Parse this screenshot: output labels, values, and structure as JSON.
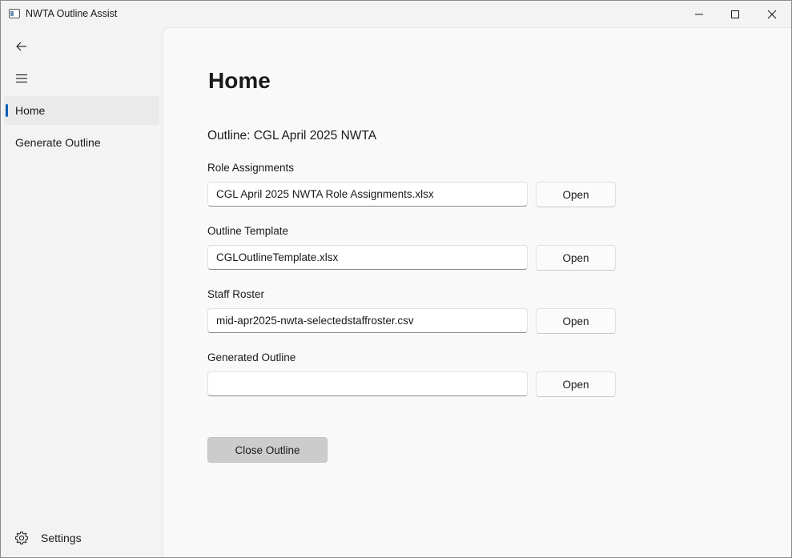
{
  "window": {
    "title": "NWTA Outline Assist"
  },
  "title_bar": {
    "icons": {
      "app": "app-window-icon",
      "minimize": "minimize-icon",
      "maximize": "maximize-icon",
      "close": "close-icon"
    }
  },
  "nav": {
    "back_icon": "arrow-left-icon",
    "menu_icon": "hamburger-menu-icon",
    "items": [
      {
        "label": "Home",
        "selected": true
      },
      {
        "label": "Generate Outline",
        "selected": false
      }
    ],
    "settings": {
      "label": "Settings",
      "icon": "gear-icon"
    },
    "accent_color": "#005fb8"
  },
  "page": {
    "title": "Home",
    "outline_label": "Outline: CGL April 2025 NWTA",
    "fields": [
      {
        "label": "Role Assignments",
        "value": "CGL April 2025 NWTA Role Assignments.xlsx",
        "button": "Open"
      },
      {
        "label": "Outline Template",
        "value": "CGLOutlineTemplate.xlsx",
        "button": "Open"
      },
      {
        "label": "Staff Roster",
        "value": "mid-apr2025-nwta-selectedstaffroster.csv",
        "button": "Open"
      },
      {
        "label": "Generated Outline",
        "value": "",
        "button": "Open"
      }
    ],
    "close_button": "Close Outline"
  }
}
